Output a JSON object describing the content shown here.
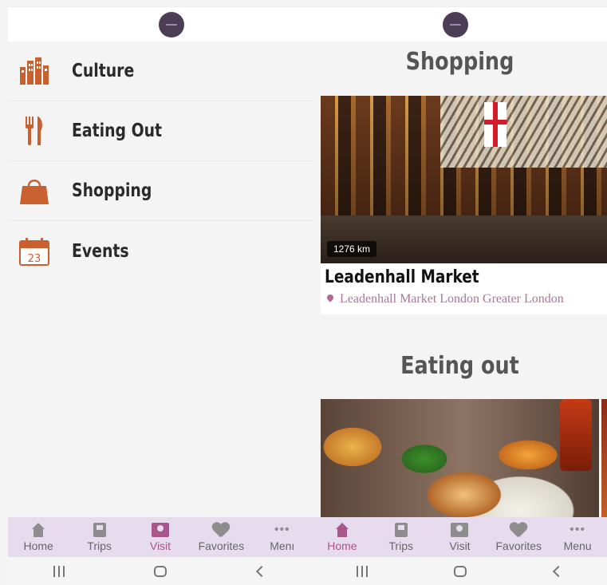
{
  "left_screen": {
    "categories": [
      {
        "label": "Culture",
        "icon": "buildings-icon"
      },
      {
        "label": "Eating Out",
        "icon": "fork-knife-icon"
      },
      {
        "label": "Shopping",
        "icon": "shopping-bag-icon"
      },
      {
        "label": "Events",
        "icon": "calendar-icon",
        "calendar_day": "23"
      }
    ],
    "nav": [
      {
        "label": "Home",
        "icon": "home-icon",
        "active": false
      },
      {
        "label": "Trips",
        "icon": "trips-icon",
        "active": false
      },
      {
        "label": "Visit",
        "icon": "visit-map-icon",
        "active": true
      },
      {
        "label": "Favorites",
        "icon": "heart-icon",
        "active": false
      },
      {
        "label": "Menı",
        "icon": "dots-icon",
        "active": false
      }
    ]
  },
  "right_screen": {
    "sections": [
      {
        "title": "Shopping",
        "card": {
          "distance": "1276 km",
          "name": "Leadenhall Market",
          "location": "Leadenhall Market London Greater London"
        }
      },
      {
        "title": "Eating out"
      }
    ],
    "nav": [
      {
        "label": "Home",
        "icon": "home-icon",
        "active": true
      },
      {
        "label": "Trips",
        "icon": "trips-icon",
        "active": false
      },
      {
        "label": "Visit",
        "icon": "visit-map-icon",
        "active": false
      },
      {
        "label": "Favorites",
        "icon": "heart-icon",
        "active": false
      },
      {
        "label": "Menu",
        "icon": "dots-icon",
        "active": false
      }
    ]
  },
  "colors": {
    "accent": "#a9568c",
    "category_icon": "#c9602f",
    "nav_background": "#e7dbee",
    "logo": "#4a3d55"
  }
}
